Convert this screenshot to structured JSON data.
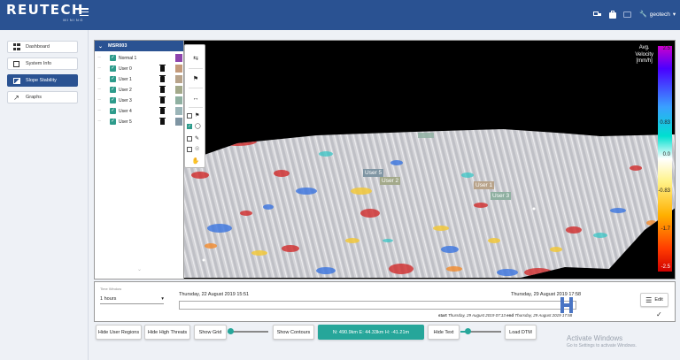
{
  "header": {
    "logo_main": "REUTECH",
    "logo_sub": "MINING",
    "user_label": "geotech",
    "icons": [
      "truck-icon",
      "bag-icon",
      "chat-icon",
      "wrench-icon"
    ]
  },
  "sidebar": {
    "items": [
      {
        "label": "Dashboard",
        "icon": "grid-icon",
        "active": false
      },
      {
        "label": "System Info",
        "icon": "document-icon",
        "active": false
      },
      {
        "label": "Slope Stability",
        "icon": "slope-icon",
        "active": true
      },
      {
        "label": "Graphs",
        "icon": "line-graph-icon",
        "active": false
      }
    ]
  },
  "layers": {
    "title": "MSR003",
    "items": [
      {
        "label": "Normal 1",
        "color": "#8e44ad",
        "trash": false
      },
      {
        "label": "User 0",
        "color": "#c49a7a",
        "trash": true
      },
      {
        "label": "User 1",
        "color": "#b8a38a",
        "trash": true
      },
      {
        "label": "User 2",
        "color": "#a3a98a",
        "trash": true
      },
      {
        "label": "User 3",
        "color": "#8fb0a1",
        "trash": true
      },
      {
        "label": "User 4",
        "color": "#9bb5b8",
        "trash": true
      },
      {
        "label": "User 5",
        "color": "#7f95a3",
        "trash": true
      }
    ]
  },
  "map": {
    "tags": [
      {
        "label": "User 5",
        "color": "#7f95a3"
      },
      {
        "label": "User 2",
        "color": "#a3a98a"
      },
      {
        "label": "User 1",
        "color": "#b8a38a"
      },
      {
        "label": "User 3",
        "color": "#8fb0a1"
      }
    ]
  },
  "legend": {
    "title_line1": "Avg.",
    "title_line2": "Velocity",
    "title_line3": "[mm/h]",
    "ticks": [
      "2.5",
      "1.7",
      "0.83",
      "0.0",
      "-0.83",
      "-1.7",
      "-2.5"
    ]
  },
  "time": {
    "window_label": "Time Window",
    "window_value": "1 hours",
    "start_date": "Thursday, 22 August 2019 15:51",
    "end_date": "Thursday, 29 August 2019 17:58",
    "range_start_label": "start",
    "range_start": "Thursday, 29 August 2019 07:13",
    "range_end_label": "end",
    "range_end": "Thursday, 29 August 2019 17:58",
    "edit_label": "Edit"
  },
  "buttons": {
    "hide_user_regions": "Hide User Regions",
    "hide_high_threats": "Hide High Threats",
    "show_grid": "Show Grid",
    "show_contours": "Show Contours",
    "coordinates": "N: 490.9km E: 44.33km H: -41.21m",
    "hide_text": "Hide Text",
    "load_dtm": "Load DTM"
  },
  "watermark": {
    "title": "Activate Windows",
    "sub": "Go to Settings to activate Windows."
  }
}
